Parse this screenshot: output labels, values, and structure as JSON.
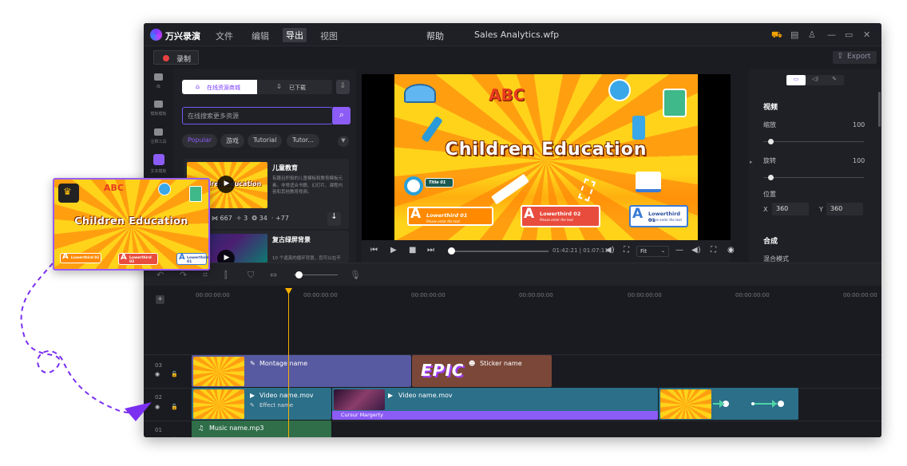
{
  "app": {
    "brand": "万兴录演",
    "menus": [
      "文件",
      "编辑",
      "导出",
      "视图"
    ],
    "help": "帮助",
    "file_title": "Sales Analytics.wfp",
    "record_label": "录制",
    "export_label": "Export",
    "colors": {
      "accent": "#8c5cf6",
      "record": "#e84140",
      "playhead": "#f5b000"
    }
  },
  "sidebar": {
    "items": [
      {
        "label": "库",
        "icon": "folder-icon"
      },
      {
        "label": "模板模板",
        "icon": "template-icon"
      },
      {
        "label": "注释工具",
        "icon": "annotation-icon"
      },
      {
        "label": "文本模板",
        "icon": "text-template-icon"
      }
    ]
  },
  "resources": {
    "tab_online": "在线资源商城",
    "tab_downloaded": "已下载",
    "search_placeholder": "在线搜索更多资源",
    "chips": [
      "Popular",
      "游戏",
      "Tutorial",
      "Tutor..."
    ],
    "cards": [
      {
        "title": "儿童教育",
        "desc": "有趣且积极的儿童模板和教育模板元素。非常适合书籍、幻灯片、课程内容和其他教育视频。",
        "stats": [
          "667",
          "3",
          "34",
          "+77"
        ]
      },
      {
        "title": "复古绿屏背景",
        "desc": "10 个逼真的循环背景，您可以在不"
      }
    ]
  },
  "preview": {
    "title": "Children Education",
    "abc": "ABC",
    "title01": "Title 01",
    "lowerthird1": "Lowerthird 01",
    "lowerthird2": "Lowerthird 02",
    "lowerthird3": "Lowerthird 01",
    "lowerthird_sub": "Please enter the text",
    "timecode": "01:42:21 | 01:07:11",
    "fit": "Fit"
  },
  "properties": {
    "section_video": "视频",
    "scale_label": "缩放",
    "scale_value": "100",
    "rotate_label": "旋转",
    "rotate_value": "100",
    "position_label": "位置",
    "x_label": "X",
    "x_value": "360",
    "y_label": "Y",
    "y_value": "360",
    "section_composite": "合成",
    "blend_label": "混合模式"
  },
  "timeline": {
    "ruler": [
      "00:00:00:00",
      "00:00:00:00",
      "00:00:00:00",
      "00:00:00:00",
      "00:00:00:00",
      "00:00:00:00",
      "00:00:00:00"
    ],
    "tracks": [
      {
        "num": "03"
      },
      {
        "num": "02"
      },
      {
        "num": "01"
      }
    ],
    "clips": {
      "montage": "Montage name",
      "sticker": "Sticker name",
      "sticker_text": "EPIC",
      "video1": "Video name.mov",
      "effect": "Effect name",
      "video2": "Video name.mov",
      "cursor": "Cursur Margerty",
      "music": "Music name.mp3"
    }
  }
}
